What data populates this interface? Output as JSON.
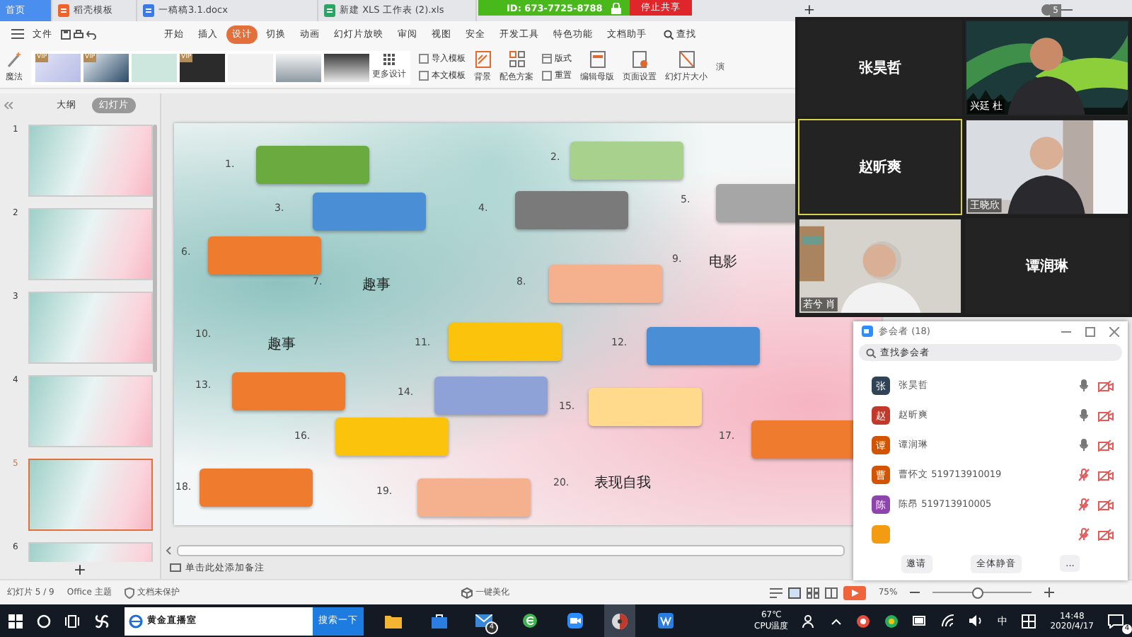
{
  "browser_tabs": [
    {
      "label": "首页",
      "kind": "home",
      "selected": true
    },
    {
      "label": "稻壳模板",
      "kind": "docer",
      "selected": false
    },
    {
      "label": "一稿稿3.1.docx",
      "kind": "doc",
      "selected": false
    },
    {
      "label": "新建 XLS 工作表 (2).xls",
      "kind": "xls",
      "selected": false
    }
  ],
  "add_tab": "+",
  "title_badge": "5",
  "share_bar": {
    "meeting_id": "ID: 673-7725-8788",
    "stop_button": "停止共享"
  },
  "menu": {
    "file": "文件",
    "items": [
      {
        "label": "开始",
        "selected": false
      },
      {
        "label": "插入",
        "selected": false
      },
      {
        "label": "设计",
        "selected": true
      },
      {
        "label": "切换",
        "selected": false
      },
      {
        "label": "动画",
        "selected": false
      },
      {
        "label": "幻灯片放映",
        "selected": false
      },
      {
        "label": "审阅",
        "selected": false
      },
      {
        "label": "视图",
        "selected": false
      },
      {
        "label": "安全",
        "selected": false
      },
      {
        "label": "开发工具",
        "selected": false
      },
      {
        "label": "特色功能",
        "selected": false
      },
      {
        "label": "文档助手",
        "selected": false
      }
    ],
    "search": "查找"
  },
  "ribbon": {
    "magic": "魔法",
    "templates": [
      {
        "kind": "vip",
        "badge": "VIP"
      },
      {
        "kind": "vip",
        "badge": "VIP"
      },
      {
        "kind": "plain"
      },
      {
        "kind": "vip",
        "badge": "VIP"
      },
      {
        "kind": "plain"
      },
      {
        "kind": "plain"
      },
      {
        "kind": "plain"
      }
    ],
    "more_designs": "更多设计",
    "import_template": "导入模板",
    "this_template": "本文模板",
    "background": "背景",
    "color_scheme": "配色方案",
    "layout": "版式",
    "reset": "重置",
    "edit_master": "编辑母版",
    "page_setup": "页面设置",
    "slide_size": "幻灯片大小",
    "cut_item": "演"
  },
  "slide_pane": {
    "tabs": [
      {
        "label": "大纲",
        "selected": false
      },
      {
        "label": "幻灯片",
        "selected": true
      }
    ],
    "thumbnails": [
      {
        "number": "1",
        "selected": false
      },
      {
        "number": "2",
        "selected": false
      },
      {
        "number": "3",
        "selected": false
      },
      {
        "number": "4",
        "selected": false
      },
      {
        "number": "5",
        "selected": true
      },
      {
        "number": "6",
        "selected": false
      }
    ],
    "add_button": "+"
  },
  "slide": {
    "items": [
      {
        "number": "1.",
        "kind": "box",
        "color": "#6aaa3f"
      },
      {
        "number": "2.",
        "kind": "box",
        "color": "#a9d18e"
      },
      {
        "number": "3.",
        "kind": "box",
        "color": "#4a8fd6"
      },
      {
        "number": "4.",
        "kind": "box",
        "color": "#7a7a7a"
      },
      {
        "number": "5.",
        "kind": "box",
        "color": "#a6a6a6"
      },
      {
        "number": "6.",
        "kind": "box",
        "color": "#ef7b2f"
      },
      {
        "number": "7.",
        "kind": "text",
        "answer": "趣事"
      },
      {
        "number": "8.",
        "kind": "box",
        "color": "#f5b08e"
      },
      {
        "number": "9.",
        "kind": "text",
        "answer": "电影"
      },
      {
        "number": "10.",
        "kind": "text",
        "answer": "趣事"
      },
      {
        "number": "11.",
        "kind": "box",
        "color": "#fcc30c"
      },
      {
        "number": "12.",
        "kind": "box",
        "color": "#4a8fd6"
      },
      {
        "number": "13.",
        "kind": "box",
        "color": "#ef7b2f"
      },
      {
        "number": "14.",
        "kind": "box",
        "color": "#8fa2d8"
      },
      {
        "number": "15.",
        "kind": "box",
        "color": "#ffd98c"
      },
      {
        "number": "16.",
        "kind": "box",
        "color": "#fcc30c"
      },
      {
        "number": "17.",
        "kind": "box",
        "color": "#ef7b2f"
      },
      {
        "number": "18.",
        "kind": "box",
        "color": "#ef7b2f"
      },
      {
        "number": "19.",
        "kind": "box",
        "color": "#f5b08e"
      },
      {
        "number": "20.",
        "kind": "text",
        "answer": "表现自我"
      }
    ]
  },
  "notes_placeholder": "单击此处添加备注",
  "status_bar": {
    "slide_count": "幻灯片 5 / 9",
    "theme": "Office 主题",
    "protection": "文档未保护",
    "beautify": "一键美化",
    "zoom": "75%",
    "zoom_slider": {
      "level": 0.45
    }
  },
  "video_window": {
    "tiles": [
      {
        "kind": "name",
        "name": "张昊哲",
        "selected": false
      },
      {
        "kind": "video",
        "label": "兴廷 杜",
        "selected": false
      },
      {
        "kind": "name",
        "name": "赵昕爽",
        "selected": true
      },
      {
        "kind": "video",
        "label": "王晓欣",
        "selected": false
      },
      {
        "kind": "video",
        "label": "若兮 肖",
        "selected": false
      },
      {
        "kind": "name",
        "name": "谭润琳",
        "selected": false
      }
    ]
  },
  "participants": {
    "title": "参会者 (18)",
    "search_placeholder": "查找参会者",
    "people": [
      {
        "avatar": "张",
        "name": "张昊哲",
        "color": "#2f4256",
        "mic_muted": false
      },
      {
        "avatar": "赵",
        "name": "赵昕爽",
        "color": "#c0392b",
        "mic_muted": false
      },
      {
        "avatar": "谭",
        "name": "谭润琳",
        "color": "#d35400",
        "mic_muted": false
      },
      {
        "avatar": "曹",
        "name": "曹怀文 519713910019",
        "color": "#d35400",
        "mic_muted": true
      },
      {
        "avatar": "陈",
        "name": "陈昂 519713910005",
        "color": "#8e44ad",
        "mic_muted": true
      },
      {
        "color": "#f39c12",
        "mic_muted": true
      }
    ],
    "buttons": [
      "邀请",
      "全体静音",
      "..."
    ]
  },
  "taskbar": {
    "search_text": "黄金直播室",
    "search_button": "搜索一下",
    "apps": [
      {
        "kind": "explorer",
        "selected": false
      },
      {
        "kind": "store",
        "selected": false
      },
      {
        "kind": "mail",
        "selected": false,
        "badge": "4"
      },
      {
        "kind": "browser",
        "selected": false
      },
      {
        "kind": "zoom",
        "selected": false
      },
      {
        "kind": "media",
        "selected": true
      },
      {
        "kind": "wps",
        "selected": false
      }
    ],
    "cpu_temp": "67℃",
    "cpu_label": "CPU温度",
    "ime": "中",
    "time": "14:48",
    "date": "2020/4/17",
    "notification_badge": "4"
  }
}
